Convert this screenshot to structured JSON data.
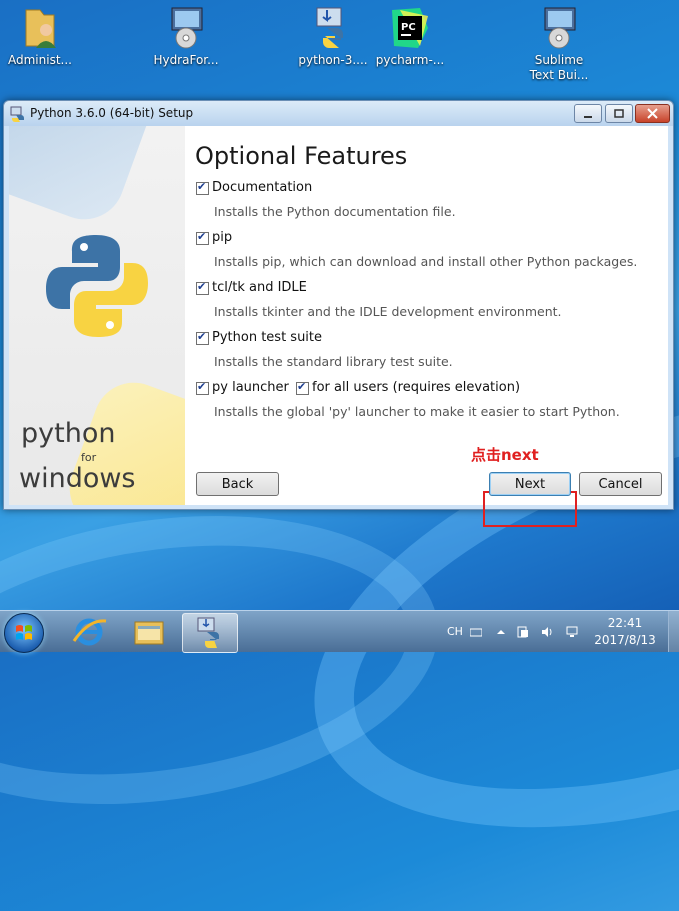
{
  "desktop": {
    "icons": [
      {
        "label": "Administ..."
      },
      {
        "label": "HydraFor..."
      },
      {
        "label": "python-3...."
      },
      {
        "label": "pycharm-..."
      },
      {
        "label_line1": "Sublime",
        "label_line2": "Text Bui..."
      }
    ]
  },
  "window": {
    "title": "Python 3.6.0 (64-bit) Setup",
    "heading": "Optional Features",
    "brand": {
      "line1": "python",
      "line2": "for",
      "line3": "windows"
    },
    "options": [
      {
        "label": "Documentation",
        "checked": true,
        "description": "Installs the Python documentation file."
      },
      {
        "label": "pip",
        "checked": true,
        "description": "Installs pip, which can download and install other Python packages."
      },
      {
        "label": "tcl/tk and IDLE",
        "checked": true,
        "description": "Installs tkinter and the IDLE development environment."
      },
      {
        "label": "Python test suite",
        "checked": true,
        "description": "Installs the standard library test suite."
      },
      {
        "label": "py launcher",
        "checked": true,
        "description": "Installs the global 'py' launcher to make it easier to start Python."
      }
    ],
    "for_all_users": {
      "label": "for all users (requires elevation)",
      "checked": true
    },
    "buttons": {
      "back": "Back",
      "next": "Next",
      "cancel": "Cancel"
    }
  },
  "annotation": {
    "text": "点击next",
    "color": "#e02020"
  },
  "taskbar": {
    "lang": "CH",
    "time": "22:41",
    "date": "2017/8/13"
  },
  "colors": {
    "python_blue": "#3d73a6",
    "python_yellow": "#f8d342",
    "accent_red": "#e02020"
  }
}
